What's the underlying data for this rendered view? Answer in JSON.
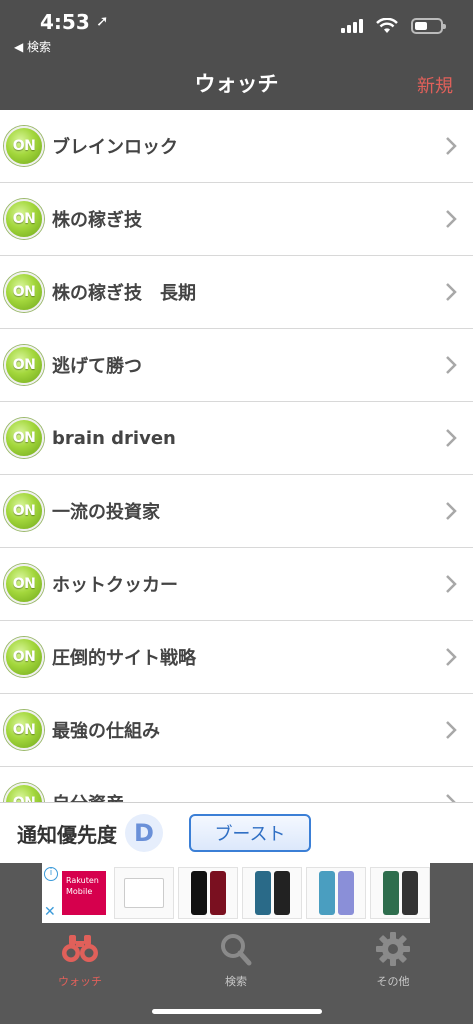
{
  "status": {
    "time": "4:53",
    "location_glyph": "➚",
    "back_label": "◀ 検索"
  },
  "nav": {
    "title": "ウォッチ",
    "new_label": "新規"
  },
  "list": {
    "badge": "ON",
    "items": [
      {
        "label": "ブレインロック"
      },
      {
        "label": "株の稼ぎ技"
      },
      {
        "label": "株の稼ぎ技　長期"
      },
      {
        "label": "逃げて勝つ"
      },
      {
        "label": "brain driven"
      },
      {
        "label": "一流の投資家"
      },
      {
        "label": "ホットクッカー"
      },
      {
        "label": "圧倒的サイト戦略"
      },
      {
        "label": "最強の仕組み"
      },
      {
        "label": "自分資産"
      }
    ]
  },
  "priority": {
    "label": "通知優先度",
    "badge_letter": "D",
    "boost_label": "ブースト"
  },
  "ad": {
    "info": "i",
    "close": "✕",
    "brand": "Rakuten Mobile"
  },
  "tabs": [
    {
      "label": "ウォッチ",
      "icon": "binoculars-icon",
      "active": true
    },
    {
      "label": "検索",
      "icon": "search-icon",
      "active": false
    },
    {
      "label": "その他",
      "icon": "gear-icon",
      "active": false
    }
  ],
  "colors": {
    "accent": "#e0605a",
    "bar": "#4e4e4e",
    "on_green": "#a3d73c",
    "boost_blue": "#3b7fd6"
  }
}
